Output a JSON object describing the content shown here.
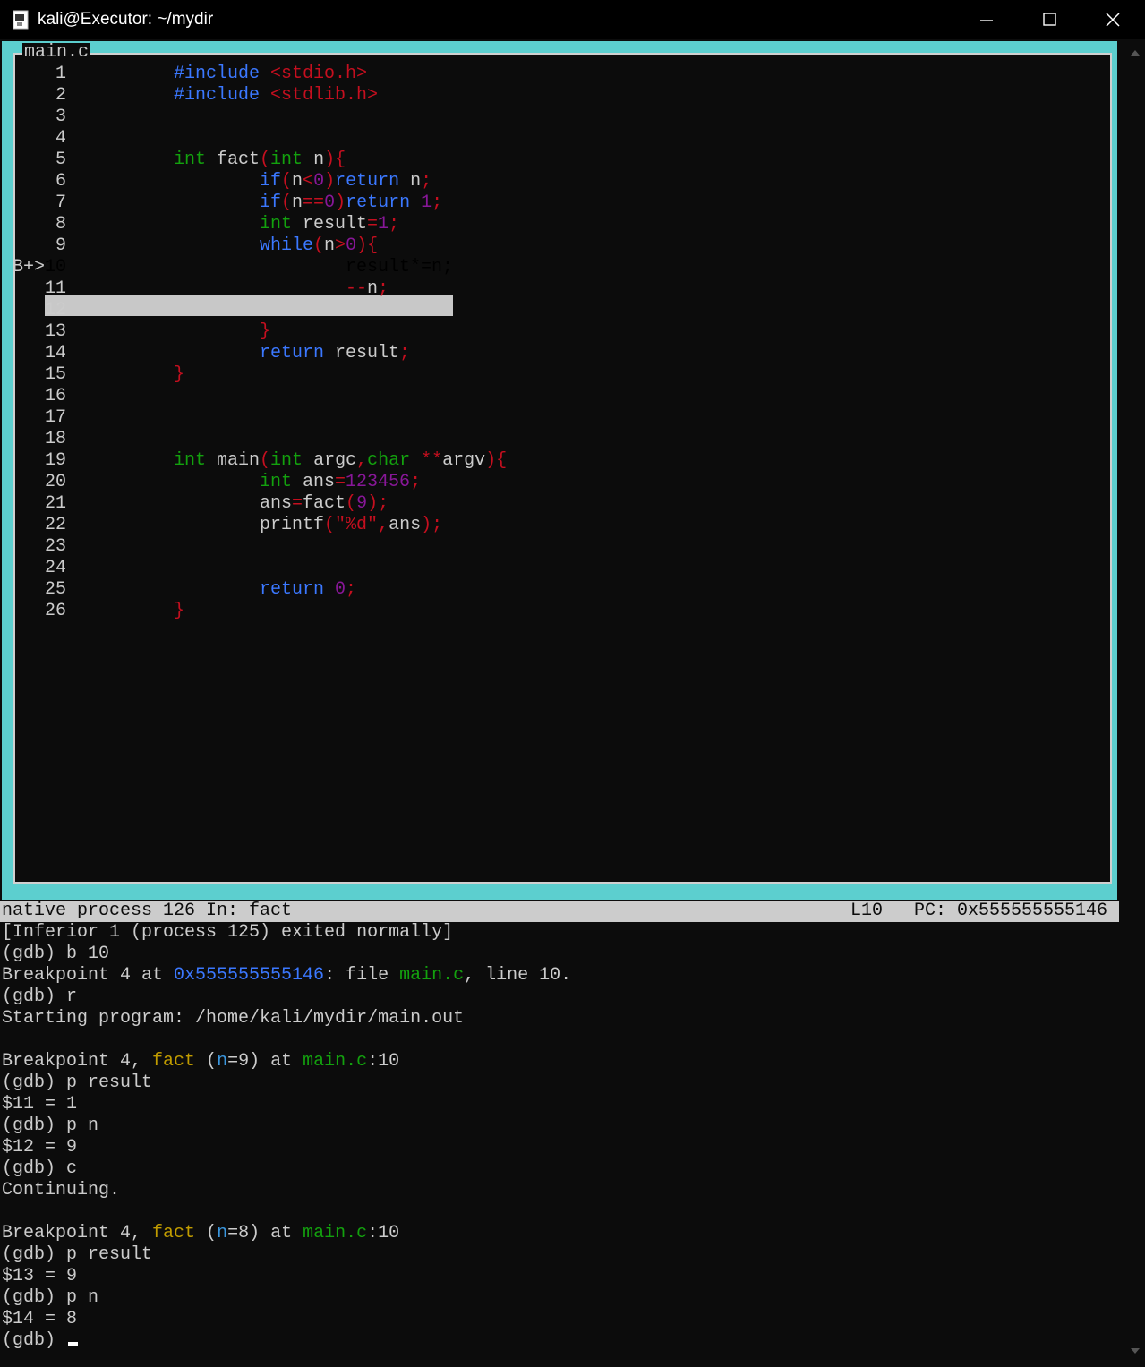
{
  "window": {
    "title": "kali@Executor: ~/mydir",
    "icon": "terminal-icon",
    "controls": [
      "minimize-icon",
      "maximize-icon",
      "close-icon"
    ]
  },
  "source_window": {
    "title": "main.c",
    "current_marker": "B+>",
    "lines": [
      {
        "n": "1",
        "code": [
          [
            "kw-b",
            "#include "
          ],
          [
            "str",
            "<stdio.h>"
          ]
        ]
      },
      {
        "n": "2",
        "code": [
          [
            "kw-b",
            "#include "
          ],
          [
            "str",
            "<stdlib.h>"
          ]
        ]
      },
      {
        "n": "3",
        "code": []
      },
      {
        "n": "4",
        "code": []
      },
      {
        "n": "5",
        "code": [
          [
            "kw-g",
            "int "
          ],
          [
            "txt",
            "fact"
          ],
          [
            "pun",
            "("
          ],
          [
            "kw-g",
            "int "
          ],
          [
            "txt",
            "n"
          ],
          [
            "pun",
            "){"
          ]
        ]
      },
      {
        "n": "6",
        "code": [
          [
            "kw-b",
            "if"
          ],
          [
            "pun",
            "("
          ],
          [
            "txt",
            "n"
          ],
          [
            "pun",
            "<"
          ],
          [
            "num",
            "0"
          ],
          [
            "pun",
            ")"
          ],
          [
            "kw-b",
            "return "
          ],
          [
            "txt",
            "n"
          ],
          [
            "pun",
            ";"
          ]
        ]
      },
      {
        "n": "7",
        "code": [
          [
            "kw-b",
            "if"
          ],
          [
            "pun",
            "("
          ],
          [
            "txt",
            "n"
          ],
          [
            "pun",
            "=="
          ],
          [
            "num",
            "0"
          ],
          [
            "pun",
            ")"
          ],
          [
            "kw-b",
            "return "
          ],
          [
            "num",
            "1"
          ],
          [
            "pun",
            ";"
          ]
        ]
      },
      {
        "n": "8",
        "code": [
          [
            "kw-g",
            "int "
          ],
          [
            "txt",
            "result"
          ],
          [
            "pun",
            "="
          ],
          [
            "num",
            "1"
          ],
          [
            "pun",
            ";"
          ]
        ]
      },
      {
        "n": "9",
        "code": [
          [
            "kw-b",
            "while"
          ],
          [
            "pun",
            "("
          ],
          [
            "txt",
            "n"
          ],
          [
            "pun",
            ">"
          ],
          [
            "num",
            "0"
          ],
          [
            "pun",
            "){"
          ]
        ]
      },
      {
        "n": "10",
        "code": [
          [
            "txt",
            "result"
          ],
          [
            "pun",
            "*="
          ],
          [
            "txt",
            "n"
          ],
          [
            "pun",
            ";"
          ]
        ]
      },
      {
        "n": "11",
        "code": [
          [
            "pun",
            "--"
          ],
          [
            "txt",
            "n"
          ],
          [
            "pun",
            ";"
          ]
        ]
      },
      {
        "n": "12",
        "code": []
      },
      {
        "n": "13",
        "code": [
          [
            "pun",
            "}"
          ]
        ]
      },
      {
        "n": "14",
        "code": [
          [
            "kw-b",
            "return "
          ],
          [
            "txt",
            "result"
          ],
          [
            "pun",
            ";"
          ]
        ]
      },
      {
        "n": "15",
        "code": [
          [
            "pun",
            "}"
          ]
        ]
      },
      {
        "n": "16",
        "code": []
      },
      {
        "n": "17",
        "code": []
      },
      {
        "n": "18",
        "code": []
      },
      {
        "n": "19",
        "code": [
          [
            "kw-g",
            "int "
          ],
          [
            "txt",
            "main"
          ],
          [
            "pun",
            "("
          ],
          [
            "kw-g",
            "int "
          ],
          [
            "txt",
            "argc"
          ],
          [
            "pun",
            ","
          ],
          [
            "kw-g",
            "char "
          ],
          [
            "pun",
            "**"
          ],
          [
            "txt",
            "argv"
          ],
          [
            "pun",
            "){"
          ]
        ]
      },
      {
        "n": "20",
        "code": [
          [
            "kw-g",
            "int "
          ],
          [
            "txt",
            "ans"
          ],
          [
            "pun",
            "="
          ],
          [
            "num",
            "123456"
          ],
          [
            "pun",
            ";"
          ]
        ]
      },
      {
        "n": "21",
        "code": [
          [
            "txt",
            "ans"
          ],
          [
            "pun",
            "="
          ],
          [
            "txt",
            "fact"
          ],
          [
            "pun",
            "("
          ],
          [
            "num",
            "9"
          ],
          [
            "pun",
            ");"
          ]
        ]
      },
      {
        "n": "22",
        "code": [
          [
            "txt",
            "printf"
          ],
          [
            "pun",
            "("
          ],
          [
            "str",
            "\"%d\""
          ],
          [
            "pun",
            ","
          ],
          [
            "txt",
            "ans"
          ],
          [
            "pun",
            ");"
          ]
        ]
      },
      {
        "n": "23",
        "code": []
      },
      {
        "n": "24",
        "code": []
      },
      {
        "n": "25",
        "code": [
          [
            "kw-b",
            "return "
          ],
          [
            "num",
            "0"
          ],
          [
            "pun",
            ";"
          ]
        ]
      },
      {
        "n": "26",
        "code": [
          [
            "pun",
            "}"
          ]
        ]
      }
    ]
  },
  "status_bar": {
    "left": "native process 126 In: fact",
    "line": "L10",
    "pc": "PC: 0x555555555146"
  },
  "console": [
    [
      [
        "",
        "[Inferior 1 (process 125) exited normally]"
      ]
    ],
    [
      [
        "",
        "(gdb) b 10"
      ]
    ],
    [
      [
        "",
        "Breakpoint 4 at "
      ],
      [
        "c-blue",
        "0x555555555146"
      ],
      [
        "",
        ": file "
      ],
      [
        "c-green",
        "main.c"
      ],
      [
        "",
        ", line 10."
      ]
    ],
    [
      [
        "",
        "(gdb) r"
      ]
    ],
    [
      [
        "",
        "Starting program: /home/kali/mydir/main.out"
      ]
    ],
    [],
    [
      [
        "",
        "Breakpoint 4, "
      ],
      [
        "c-yellow",
        "fact"
      ],
      [
        "",
        " ("
      ],
      [
        "c-cyan",
        "n"
      ],
      [
        "",
        "=9) at "
      ],
      [
        "c-green",
        "main.c"
      ],
      [
        "",
        ":10"
      ]
    ],
    [
      [
        "",
        "(gdb) p result"
      ]
    ],
    [
      [
        "",
        "$11 = 1"
      ]
    ],
    [
      [
        "",
        "(gdb) p n"
      ]
    ],
    [
      [
        "",
        "$12 = 9"
      ]
    ],
    [
      [
        "",
        "(gdb) c"
      ]
    ],
    [
      [
        "",
        "Continuing."
      ]
    ],
    [],
    [
      [
        "",
        "Breakpoint 4, "
      ],
      [
        "c-yellow",
        "fact"
      ],
      [
        "",
        " ("
      ],
      [
        "c-cyan",
        "n"
      ],
      [
        "",
        "=8) at "
      ],
      [
        "c-green",
        "main.c"
      ],
      [
        "",
        ":10"
      ]
    ],
    [
      [
        "",
        "(gdb) p result"
      ]
    ],
    [
      [
        "",
        "$13 = 9"
      ]
    ],
    [
      [
        "",
        "(gdb) p n"
      ]
    ],
    [
      [
        "",
        "$14 = 8"
      ]
    ],
    [
      [
        "",
        "(gdb) "
      ]
    ]
  ]
}
